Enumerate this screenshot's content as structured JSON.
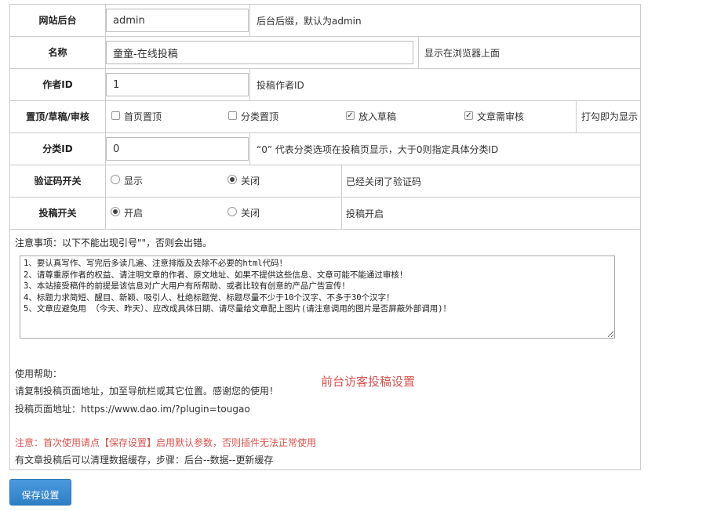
{
  "rows": {
    "backend": {
      "label": "网站后台",
      "value": "admin",
      "hint": "后台后缀，默认为admin"
    },
    "name": {
      "label": "名称",
      "value": "童童-在线投稿",
      "hint": "显示在浏览器上面"
    },
    "author": {
      "label": "作者ID",
      "value": "1",
      "hint": "投稿作者ID"
    },
    "toggles": {
      "label": "置顶/草稿/审核",
      "options": [
        {
          "label": "首页置顶",
          "checked": false
        },
        {
          "label": "分类置顶",
          "checked": false
        },
        {
          "label": "放入草稿",
          "checked": true
        },
        {
          "label": "文章需审核",
          "checked": true
        }
      ],
      "hint": "打勾即为显示"
    },
    "category": {
      "label": "分类ID",
      "value": "0",
      "hint": "“0” 代表分类选项在投稿页显示，大于0则指定具体分类ID"
    },
    "captcha": {
      "label": "验证码开关",
      "options": [
        "显示",
        "关闭"
      ],
      "selected": "关闭",
      "status": "已经关闭了验证码"
    },
    "submit": {
      "label": "投稿开关",
      "options": [
        "开启",
        "关闭"
      ],
      "selected": "开启",
      "status": "投稿开启"
    }
  },
  "notice": {
    "title": "注意事项：以下不能出现引号\"\"，否则会出错。",
    "text": "1、要认真写作、写完后多读几遍、注意排版及去除不必要的html代码！\n2、请尊重原作者的权益、请注明文章的作者、原文地址、如果不提供这些信息、文章可能不能通过审核！\n3、本站接受稿件的前提是该信息对广大用户有所帮助、或者比较有创意的产品广告宣传！\n4、标题力求简短、醒目、新颖、吸引人、杜绝标题党、标题尽量不少于10个汉字、不多于30个汉字！\n5、文章应避免用 （今天、昨天）、应改成具体日期、请尽量给文章配上图片(请注意调用的图片是否屏蔽外部调用)！"
  },
  "help": {
    "heading": "使用帮助：",
    "line1": "请复制投稿页面地址，加至导航栏或其它位置。感谢您的使用！",
    "page_url_label": "投稿页面地址：https://www.dao.im/?plugin=tougao",
    "title": "前台访客投稿设置",
    "warning": "注意：首次使用请点【保存设置】启用默认参数，否则插件无法正常使用",
    "cache_tip": "有文章投稿后可以清理数据缓存，步骤：后台--数据--更新缓存"
  },
  "save_label": "保存设置",
  "colors": {
    "accent": "#3a8bd0",
    "warning": "#d9534f",
    "border": "#cccccc"
  }
}
